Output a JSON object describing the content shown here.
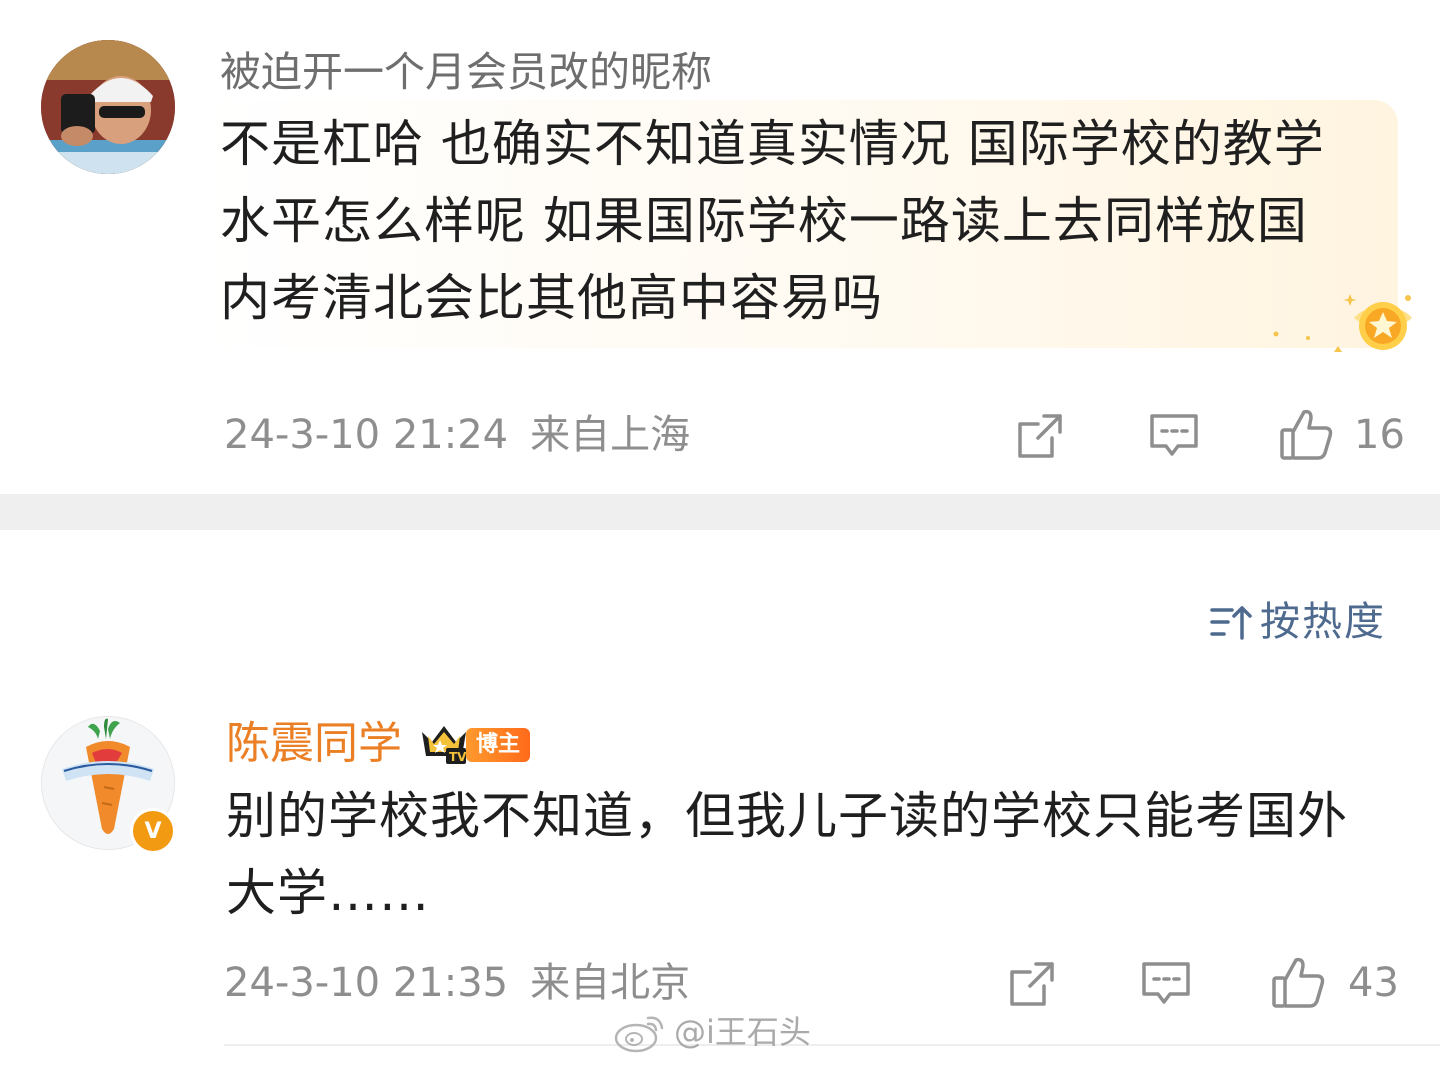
{
  "comments": [
    {
      "username": "被迫开一个月会员改的昵称",
      "text": "不是杠哈 也确实不知道真实情况 国际学校的教学\n水平怎么样呢 如果国际学校一路读上去同样放国\n内考清北会比其他高中容易吗",
      "timestamp": "24-3-10 21:24",
      "location": "来自上海",
      "likes": "16"
    },
    {
      "username": "陈震同学",
      "badge": "博主",
      "text": "别的学校我不知道，但我儿子读的学校只能考国外\n大学……",
      "timestamp": "24-3-10 21:35",
      "location": "来自北京",
      "likes": "43"
    }
  ],
  "sort": {
    "label": "按热度"
  },
  "watermark": "@i王石头",
  "colors": {
    "username_gray": "#6e6e6e",
    "username_orange": "#eb7f25",
    "meta_gray": "#8e8e8e",
    "sort_blue": "#4f6a8f",
    "separator": "#efefef"
  }
}
